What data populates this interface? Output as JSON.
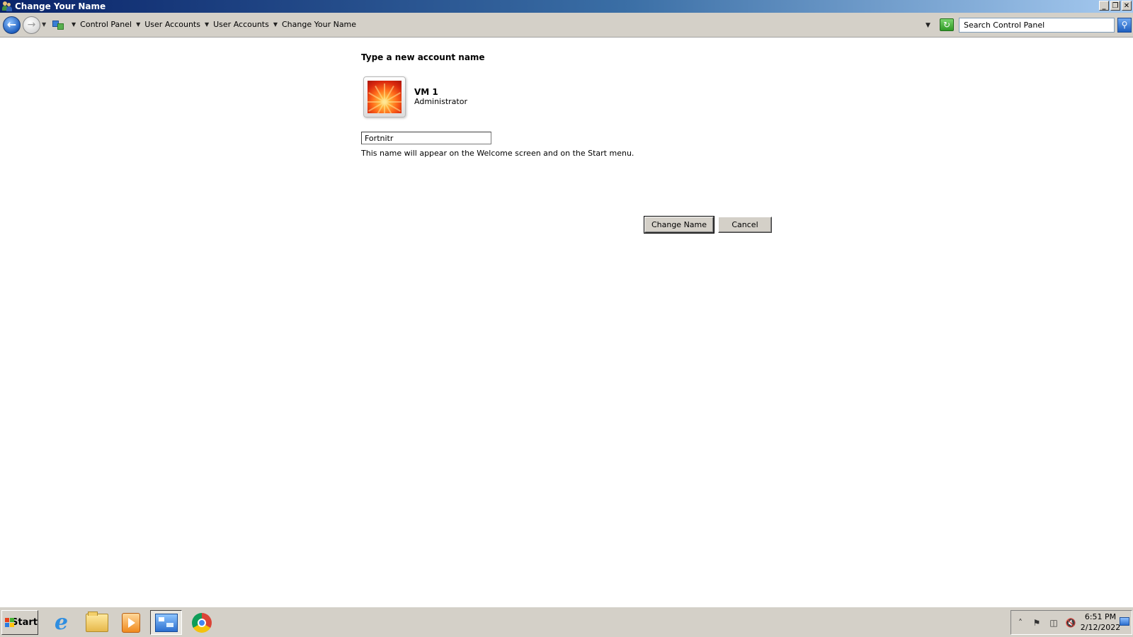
{
  "window": {
    "title": "Change Your Name",
    "controls": {
      "minimize": "_",
      "restore": "❐",
      "close": "✕"
    }
  },
  "address_bar": {
    "breadcrumbs": [
      "Control Panel",
      "User Accounts",
      "User Accounts",
      "Change Your Name"
    ],
    "search_placeholder": "Search Control Panel"
  },
  "content": {
    "heading": "Type a new account name",
    "user": {
      "name": "VM 1",
      "role": "Administrator"
    },
    "name_input_value": "Fortnitr",
    "hint": "This name will appear on the Welcome screen and on the Start menu.",
    "buttons": {
      "change": "Change Name",
      "cancel": "Cancel"
    }
  },
  "taskbar": {
    "start_label": "Start",
    "apps": [
      "internet-explorer-icon",
      "windows-explorer-icon",
      "media-player-icon",
      "control-panel-icon",
      "chrome-icon"
    ],
    "active_app": "control-panel-icon",
    "clock": {
      "time": "6:51 PM",
      "date": "2/12/2022"
    }
  },
  "colors": {
    "titlebar_start": "#0a246a",
    "titlebar_end": "#a6caf0",
    "chrome_gray": "#d4d0c8"
  }
}
